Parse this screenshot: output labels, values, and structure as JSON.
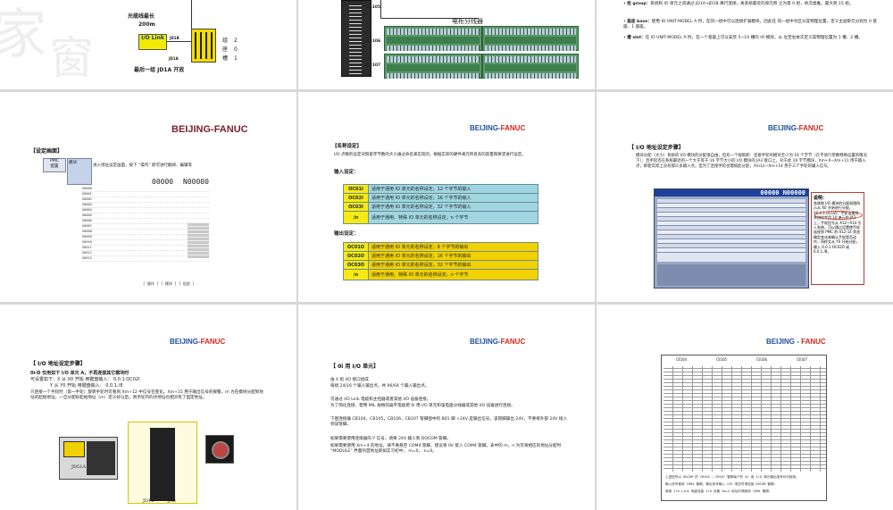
{
  "slide1": {
    "cable_length_label": "光缆线最长",
    "cable_length_value": "200m",
    "io_link_label": "I/O Link",
    "module_label": "JD1B",
    "module_label2": "JD1A",
    "groups": [
      {
        "key": "组",
        "value": "2"
      },
      {
        "key": "座",
        "value": "0"
      },
      {
        "key": "槽",
        "value": "1"
      }
    ],
    "caption": "最后一组 JD1A 开放"
  },
  "slide2": {
    "connectors": [
      "CB105",
      "CB106",
      "CB107"
    ],
    "splitter_label": "电柜分线器",
    "pin_labels": [
      "L",
      "L",
      "L"
    ]
  },
  "slide3": {
    "bullets": [
      {
        "term": "组 group：",
        "text": "系统和 IO 单元之间通过 JD1A→JD1B 串行连接，离系统最近的单元称 之为第 0 组，依次类推，最大到 15 组。"
      },
      {
        "term": "基座 base：",
        "text": "使用 IO UNIT-MODEL A 时，在同一组中可以连接扩展模块，因此在 同一组中为区分其物理位置，定义主副单元分别为 0 基座、1 基座。"
      },
      {
        "term": "槽 slot：",
        "text": "在 IO UNIT-MODEL A 时，在一个基座上可以安装 5~10 槽的 IO 模块，从 左至右依次定义其物理位置为 1 槽、2 槽。"
      }
    ]
  },
  "slide4": {
    "brand_a": "BEIJING-",
    "brand_b": "FANUC",
    "section_title": "【设定画面】",
    "pmc_label": "PMC",
    "config_label": "配置",
    "module_tab": "模块",
    "instruction": "进入地址设定画面，按下 “操作” 即可进行翻阅，编辑等",
    "counter": "00000",
    "program_no": "N00000",
    "row_codes": [
      "X0000",
      "X0001",
      "X0002",
      "X0003",
      "X0004",
      "X0005",
      "X0006",
      "X0007",
      "X0008",
      "X0009",
      "X0010",
      "X0011",
      "X0012",
      "X0013"
    ]
  },
  "slide5": {
    "brand_a": "BEIJING-",
    "brand_b": "FANUC",
    "section_title": "【名称设定】",
    "desc": "I/O 点数的设定对照第字节数的大小通过命名来实现的，根据实际的硬件来元所具有的容量和要求进行设定。",
    "input_label": "输入设定：",
    "input_rows": [
      {
        "key": "OC01I",
        "text": "适用于通用 IO 单元的名称设定，12 个字节的输入"
      },
      {
        "key": "OC02I",
        "text": "适用于通用 IO 单元的名称设定，16 个字节的输入"
      },
      {
        "key": "OC03I",
        "text": "适用于通用 IO 单元的名称设定，32 个字节的输入"
      },
      {
        "key": "/n",
        "text": "适用于通用、特殊 IO 单元的名称设定，n 个字节"
      }
    ],
    "output_label": "输出设定：",
    "output_rows": [
      {
        "key": "OC01O",
        "text": "适用于通用 IO 单元的名称设定，8 个字节的输出"
      },
      {
        "key": "OC02O",
        "text": "适用于通用 IO 单元的名称设定，16 个字节的输出"
      },
      {
        "key": "OC03O",
        "text": "适用于通用 IO 单元的名称设定，32 个字节的输出"
      },
      {
        "key": "/n",
        "text": "适用于通用、特殊 IO 单元的名称设定，n 个字节"
      }
    ]
  },
  "slide6": {
    "brand_a": "BEIJING-",
    "brand_b": "FANUC",
    "section_title": "【 I/O 地址设定步骤】",
    "bullet": "模块分配（大小）系统的 I/O 模块的分配很自由，但有一个规则即：连接手轮的模块至少为 16 个字节（在不进行参数特殊设置的情况下），且手轮连在系统最近的一个大于等于 16 字节大小的 I/O 模块的 JA3 接口上，对于此 16 字节模块，Xm+0~Xm+11 用于输入点，即使实际上没有那么多输入点，但为了连接手轮也需如此分配，Xm12~Xm+14 用于三个手轮的输入信号。",
    "screen_title": "00000 N00000",
    "note_title": "说明：",
    "note_text": "系统和 I/O 模块的分配如图所示从 X0 开始进行分配，X0.0.1.OC02I，手轮连接到系统的专用 10 单元的 JA3 上，手轮信号从 X12~X14 引入系统，可以通过设置使手轮连接到 PMC 的 X12-14 状态确定变化来确认手轮是否动作，同样文从 Y0 开始分配，输入 0.0.1.OC02O 或 0.0.1./8。"
  },
  "slide7": {
    "brand_a": "BEIJING-",
    "brand_b": "FANUC",
    "section_title": "【 I/O 地址设定步骤】",
    "line1": "0i-D 仅用如下 I/O 单元 A，不再连接其它模块时",
    "line2": "可设置如下：X 从 X0 开始  用键盘输入： 0.0.1.OC02I",
    "line3": "Y 从 Y0 开始  用键盘输入： 0.0.1./8",
    "bullet": "只连接一个手轮时（第一手轮）旋转手轮时可看到 Xm+12 中信号在变化。Xm+15 用于输出信号的报警。m 为在模块分配到地址的起始地址，一旦分配好起始地址（m）定义好以后，则手轮内的点地址也相对有了固定地址。",
    "label_jd51a": "JD51A",
    "label_jd1b": "JD1B",
    "label_ja3": "JA3"
  },
  "slide8": {
    "brand_a": "BEIJING-",
    "brand_b": "FANUC",
    "section_title": "【 0i 用 I/O 单元】",
    "p1": "由 4 组 I/O 接口组成",
    "p2": "每组 24/16 个输入输出点，共 96/64 个输入输出点。",
    "p3": "可通过 I/O Link 电缆和主控器或者其他 I/O 设备连接。",
    "p4": "为了简化连接，使用 MIL 规格的扁平电缆把 0i 用 I/O 单元和强电盘分线器或其他 I/O 设备进行连接。",
    "p5": "下图连接器 CB104，CB105，CB106，CB107 管脚图中的 B01 脚 +24V 是输出信号，该管脚输出 24V，不要将外部 24V 接入到该管脚。",
    "p6": "如果需要使用连接器的 Y 信号，请将 24V 输入到 DOCOM 管脚。",
    "p7": "如果需要使用 Xm+4 的地址，请不要悬空 COM4 管脚，建议将 0V 接入 COM4 管脚。表中的 m，n 为可将相应的地址分配时 “MODULE” 界面的首地址即如实习初中， m=0， n=0。"
  },
  "slide9": {
    "brand_a": "BEIJING - ",
    "brand_b": "FANUC",
    "table_headers": [
      "CB104",
      "CB105",
      "CB106",
      "CB107"
    ],
    "footer_lines": [
      "上述信号以 DOCOM 的 CB104 – CB107 管脚每个的 0i 用 I/O 单元输出信号均可使用。",
      "输入信号使用 COM4 管脚，输出信号输入 24V 电压时请连接 DOCOM 管脚。",
      "使用 I/O Link 电缆连接 I/O 设备 Xm+4 地址时请使用 COM4 管脚。"
    ]
  }
}
